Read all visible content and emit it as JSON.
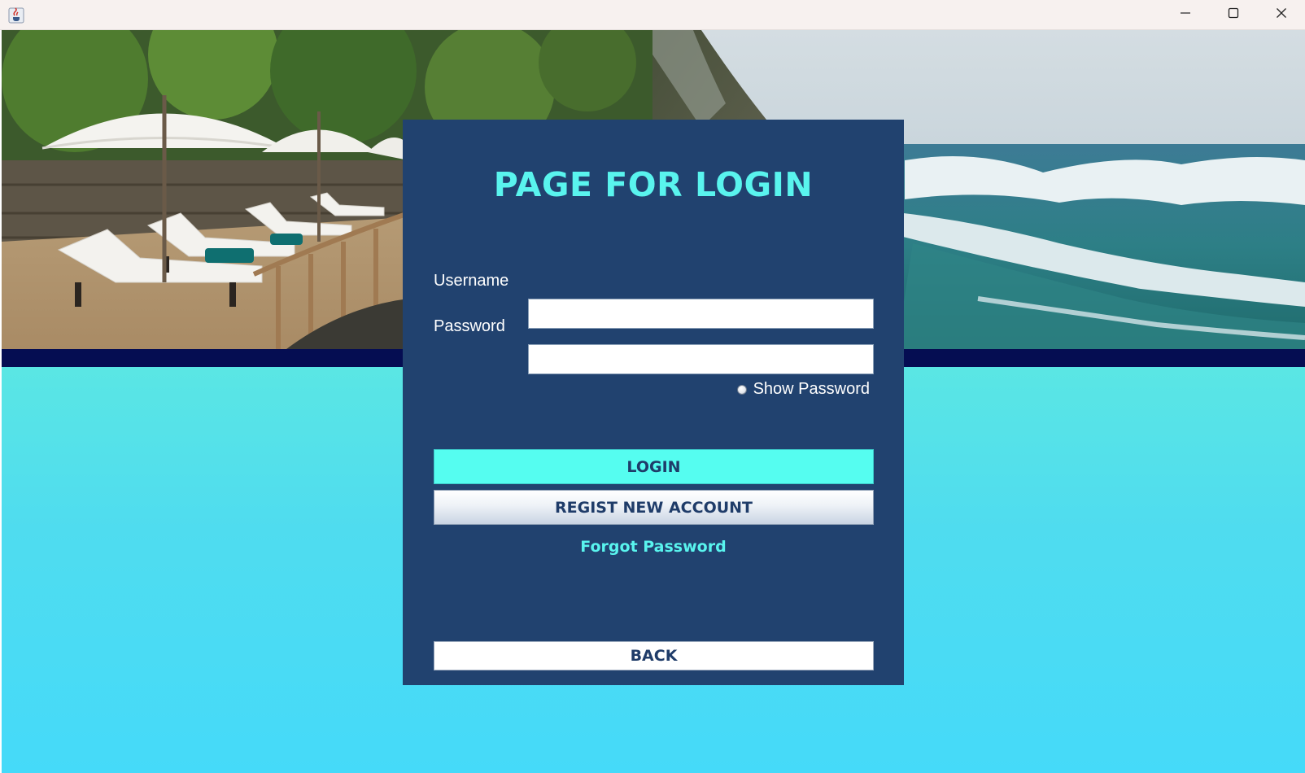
{
  "window": {
    "title": "",
    "app_icon": "java-cup-icon",
    "controls": {
      "minimize_icon": "minimize-icon",
      "maximize_icon": "maximize-icon",
      "close_icon": "close-icon"
    }
  },
  "hero": {
    "image": "beach-resort-photo"
  },
  "colors": {
    "panel_bg": "#21426f",
    "title_accent": "#59f4ee",
    "login_button": "#55fdf0",
    "stripe": "#050d52",
    "background_top": "#5ae6e4",
    "background_bottom": "#45daf9"
  },
  "login": {
    "title": "PAGE FOR LOGIN",
    "username_label": "Username",
    "username_value": "",
    "password_label": "Password",
    "password_value": "",
    "show_password_label": "Show Password",
    "show_password_checked": false,
    "login_button": "LOGIN",
    "regist_button": "REGIST NEW ACCOUNT",
    "forgot_link": "Forgot Password",
    "back_button": "BACK"
  }
}
